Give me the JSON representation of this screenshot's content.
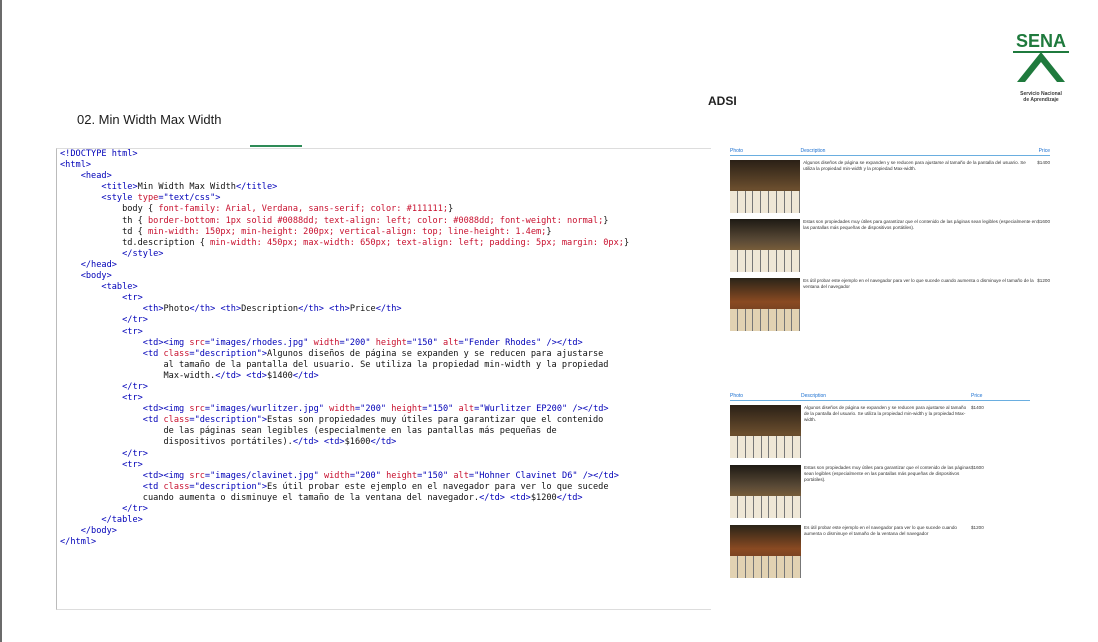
{
  "slide": {
    "title": "02. Min Width Max Width",
    "tag": "ADSI",
    "logo_text": "SENA",
    "logo_caption": "Servicio Nacional\nde Aprendizaje"
  },
  "code_lines": [
    [
      [
        "t",
        "<!DOCTYPE html>"
      ]
    ],
    [
      [
        "t",
        "<html>"
      ]
    ],
    [
      [
        "",
        "    "
      ],
      [
        "t",
        "<head>"
      ]
    ],
    [
      [
        "",
        "        "
      ],
      [
        "t",
        "<title>"
      ],
      [
        "",
        "Min Width Max Width"
      ],
      [
        "t",
        "</title>"
      ]
    ],
    [
      [
        "",
        "        "
      ],
      [
        "t",
        "<style "
      ],
      [
        "a",
        "type"
      ],
      [
        "t",
        "="
      ],
      [
        "v",
        "\"text/css\""
      ],
      [
        "t",
        ">"
      ]
    ],
    [
      [
        "",
        "            body { "
      ],
      [
        "c",
        "font-family: Arial, Verdana, sans-serif; color: #111111;"
      ],
      [
        "",
        "}"
      ]
    ],
    [
      [
        "",
        "            th { "
      ],
      [
        "c",
        "border-bottom: 1px solid #0088dd; text-align: left; color: #0088dd; font-weight: normal;"
      ],
      [
        "",
        "}"
      ]
    ],
    [
      [
        "",
        "            td { "
      ],
      [
        "c",
        "min-width: 150px; min-height: 200px; vertical-align: top; line-height: 1.4em;"
      ],
      [
        "",
        "}"
      ]
    ],
    [
      [
        "",
        "            td.description { "
      ],
      [
        "c",
        "min-width: 450px; max-width: 650px; text-align: left; padding: 5px; margin: 0px;"
      ],
      [
        "",
        "}"
      ]
    ],
    [
      [
        "",
        "            "
      ],
      [
        "t",
        "</style>"
      ]
    ],
    [
      [
        "",
        "    "
      ],
      [
        "t",
        "</head>"
      ]
    ],
    [
      [
        "",
        "    "
      ],
      [
        "t",
        "<body>"
      ]
    ],
    [
      [
        "",
        "        "
      ],
      [
        "t",
        "<table>"
      ]
    ],
    [
      [
        "",
        "            "
      ],
      [
        "t",
        "<tr>"
      ]
    ],
    [
      [
        "",
        "                "
      ],
      [
        "t",
        "<th>"
      ],
      [
        "",
        "Photo"
      ],
      [
        "t",
        "</th>"
      ],
      [
        "",
        " "
      ],
      [
        "t",
        "<th>"
      ],
      [
        "",
        "Description"
      ],
      [
        "t",
        "</th>"
      ],
      [
        "",
        " "
      ],
      [
        "t",
        "<th>"
      ],
      [
        "",
        "Price"
      ],
      [
        "t",
        "</th>"
      ]
    ],
    [
      [
        "",
        "            "
      ],
      [
        "t",
        "</tr>"
      ]
    ],
    [
      [
        "",
        "            "
      ],
      [
        "t",
        "<tr>"
      ]
    ],
    [
      [
        "",
        "                "
      ],
      [
        "t",
        "<td><img "
      ],
      [
        "a",
        "src"
      ],
      [
        "t",
        "="
      ],
      [
        "v",
        "\"images/rhodes.jpg\""
      ],
      [
        "",
        " "
      ],
      [
        "a",
        "width"
      ],
      [
        "t",
        "="
      ],
      [
        "v",
        "\"200\""
      ],
      [
        "",
        " "
      ],
      [
        "a",
        "height"
      ],
      [
        "t",
        "="
      ],
      [
        "v",
        "\"150\""
      ],
      [
        "",
        " "
      ],
      [
        "a",
        "alt"
      ],
      [
        "t",
        "="
      ],
      [
        "v",
        "\"Fender Rhodes\""
      ],
      [
        "t",
        " /></td>"
      ]
    ],
    [
      [
        "",
        "                "
      ],
      [
        "t",
        "<td "
      ],
      [
        "a",
        "class"
      ],
      [
        "t",
        "="
      ],
      [
        "v",
        "\"description\""
      ],
      [
        "t",
        ">"
      ],
      [
        "",
        "Algunos diseños de página se expanden y se reducen para ajustarse"
      ]
    ],
    [
      [
        "",
        "                    al tamaño de la pantalla del usuario. Se utiliza la propiedad min-width y la propiedad"
      ]
    ],
    [
      [
        "",
        "                    Max-width."
      ],
      [
        "t",
        "</td>"
      ],
      [
        "",
        " "
      ],
      [
        "t",
        "<td>"
      ],
      [
        "",
        "$1400"
      ],
      [
        "t",
        "</td>"
      ]
    ],
    [
      [
        "",
        "            "
      ],
      [
        "t",
        "</tr>"
      ]
    ],
    [
      [
        "",
        "            "
      ],
      [
        "t",
        "<tr>"
      ]
    ],
    [
      [
        "",
        "                "
      ],
      [
        "t",
        "<td><img "
      ],
      [
        "a",
        "src"
      ],
      [
        "t",
        "="
      ],
      [
        "v",
        "\"images/wurlitzer.jpg\""
      ],
      [
        "",
        " "
      ],
      [
        "a",
        "width"
      ],
      [
        "t",
        "="
      ],
      [
        "v",
        "\"200\""
      ],
      [
        "",
        " "
      ],
      [
        "a",
        "height"
      ],
      [
        "t",
        "="
      ],
      [
        "v",
        "\"150\""
      ],
      [
        "",
        " "
      ],
      [
        "a",
        "alt"
      ],
      [
        "t",
        "="
      ],
      [
        "v",
        "\"Wurlitzer EP200\""
      ],
      [
        "t",
        " /></td>"
      ]
    ],
    [
      [
        "",
        "                "
      ],
      [
        "t",
        "<td "
      ],
      [
        "a",
        "class"
      ],
      [
        "t",
        "="
      ],
      [
        "v",
        "\"description\""
      ],
      [
        "t",
        ">"
      ],
      [
        "",
        "Estas son propiedades muy útiles para garantizar que el contenido"
      ]
    ],
    [
      [
        "",
        "                    de las páginas sean legibles (especialmente en las pantallas más pequeñas de"
      ]
    ],
    [
      [
        "",
        "                    dispositivos portátiles)."
      ],
      [
        "t",
        "</td>"
      ],
      [
        "",
        " "
      ],
      [
        "t",
        "<td>"
      ],
      [
        "",
        "$1600"
      ],
      [
        "t",
        "</td>"
      ]
    ],
    [
      [
        "",
        "            "
      ],
      [
        "t",
        "</tr>"
      ]
    ],
    [
      [
        "",
        "            "
      ],
      [
        "t",
        "<tr>"
      ]
    ],
    [
      [
        "",
        "                "
      ],
      [
        "t",
        "<td><img "
      ],
      [
        "a",
        "src"
      ],
      [
        "t",
        "="
      ],
      [
        "v",
        "\"images/clavinet.jpg\""
      ],
      [
        "",
        " "
      ],
      [
        "a",
        "width"
      ],
      [
        "t",
        "="
      ],
      [
        "v",
        "\"200\""
      ],
      [
        "",
        " "
      ],
      [
        "a",
        "height"
      ],
      [
        "t",
        "="
      ],
      [
        "v",
        "\"150\""
      ],
      [
        "",
        " "
      ],
      [
        "a",
        "alt"
      ],
      [
        "t",
        "="
      ],
      [
        "v",
        "\"Hohner Clavinet D6\""
      ],
      [
        "t",
        " /></td>"
      ]
    ],
    [
      [
        "",
        "                "
      ],
      [
        "t",
        "<td "
      ],
      [
        "a",
        "class"
      ],
      [
        "t",
        "="
      ],
      [
        "v",
        "\"description\""
      ],
      [
        "t",
        ">"
      ],
      [
        "",
        "Es útil probar este ejemplo en el navegador para ver lo que sucede"
      ]
    ],
    [
      [
        "",
        "                cuando aumenta o disminuye el tamaño de la ventana del navegador."
      ],
      [
        "t",
        "</td>"
      ],
      [
        "",
        " "
      ],
      [
        "t",
        "<td>"
      ],
      [
        "",
        "$1200"
      ],
      [
        "t",
        "</td>"
      ]
    ],
    [
      [
        "",
        "            "
      ],
      [
        "t",
        "</tr>"
      ]
    ],
    [
      [
        "",
        "        "
      ],
      [
        "t",
        "</table>"
      ]
    ],
    [
      [
        "",
        "    "
      ],
      [
        "t",
        "</body>"
      ]
    ],
    [
      [
        "t",
        "</html>"
      ]
    ]
  ],
  "preview": {
    "headers": [
      "Photo",
      "Description",
      "Price"
    ],
    "rows": [
      {
        "desc": "Algunos diseños de página se expanden y se reducen para ajustarse al tamaño de la pantalla del usuario. Se utiliza la propiedad min-width y la propiedad Max-width.",
        "price": "$1400"
      },
      {
        "desc": "Estas son propiedades muy útiles para garantizar que el contenido de las páginas sean legibles (especialmente en las pantallas más pequeñas de dispositivos portátiles).",
        "price": "$1600"
      },
      {
        "desc": "Es útil probar este ejemplo en el navegador para ver lo que sucede cuando aumenta o disminuye el tamaño de la ventana del navegador",
        "price": "$1200"
      }
    ]
  },
  "colors": {
    "tag": "#0000b8",
    "attr": "#c8102e",
    "value": "#0000b8",
    "header": "#1a6fd0",
    "logo_green": "#2e8b57"
  }
}
